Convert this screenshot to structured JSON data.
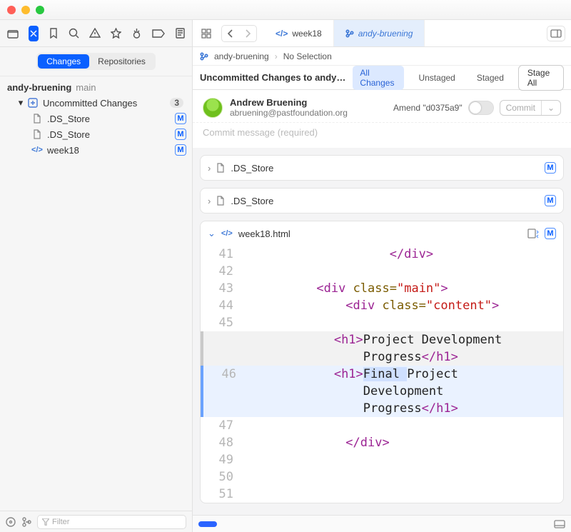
{
  "sidebar": {
    "segmented": {
      "changes": "Changes",
      "repos": "Repositories"
    },
    "repo_name": "andy-bruening",
    "branch": "main",
    "uncommitted_label": "Uncommitted Changes",
    "uncommitted_count": "3",
    "files": [
      {
        "name": ".DS_Store",
        "badge": "M",
        "icon": "file"
      },
      {
        "name": ".DS_Store",
        "badge": "M",
        "icon": "file"
      },
      {
        "name": "week18",
        "badge": "M",
        "icon": "code"
      }
    ],
    "filter_placeholder": "Filter"
  },
  "tabs": {
    "t0": {
      "label": "week18"
    },
    "t1": {
      "label": "andy-bruening"
    }
  },
  "breadcrumb": {
    "a": "andy-bruening",
    "b": "No Selection"
  },
  "changes_bar": {
    "title": "Uncommitted Changes to andy…",
    "all": "All Changes",
    "unstaged": "Unstaged",
    "staged": "Staged",
    "stage_all": "Stage All"
  },
  "author": {
    "name": "Andrew Bruening",
    "email": "abruening@pastfoundation.org",
    "amend_label": "Amend \"d0375a9\"",
    "commit_label": "Commit"
  },
  "commit_msg_placeholder": "Commit message (required)",
  "cards": {
    "c0": ".DS_Store",
    "c1": ".DS_Store",
    "c2": "week18.html",
    "m_badge": "M"
  },
  "diff": {
    "l41": "41",
    "l42": "42",
    "l43": "43",
    "l44": "44",
    "l45": "45",
    "l46": "46",
    "l47": "47",
    "l48": "48",
    "l49": "49",
    "l50": "50",
    "l51": "51",
    "div_close": "</div>",
    "div_main_open_a": "<div",
    "cls_attr": "class=",
    "main_str": "\"main\"",
    "close_gt": ">",
    "content_str": "\"content\"",
    "h1_open": "<h1>",
    "h1_close": "</h1>",
    "proj": "Project Development",
    "progress": "Progress",
    "final_word": "Final ",
    "final_rest": "Project",
    "dev": "Development"
  }
}
